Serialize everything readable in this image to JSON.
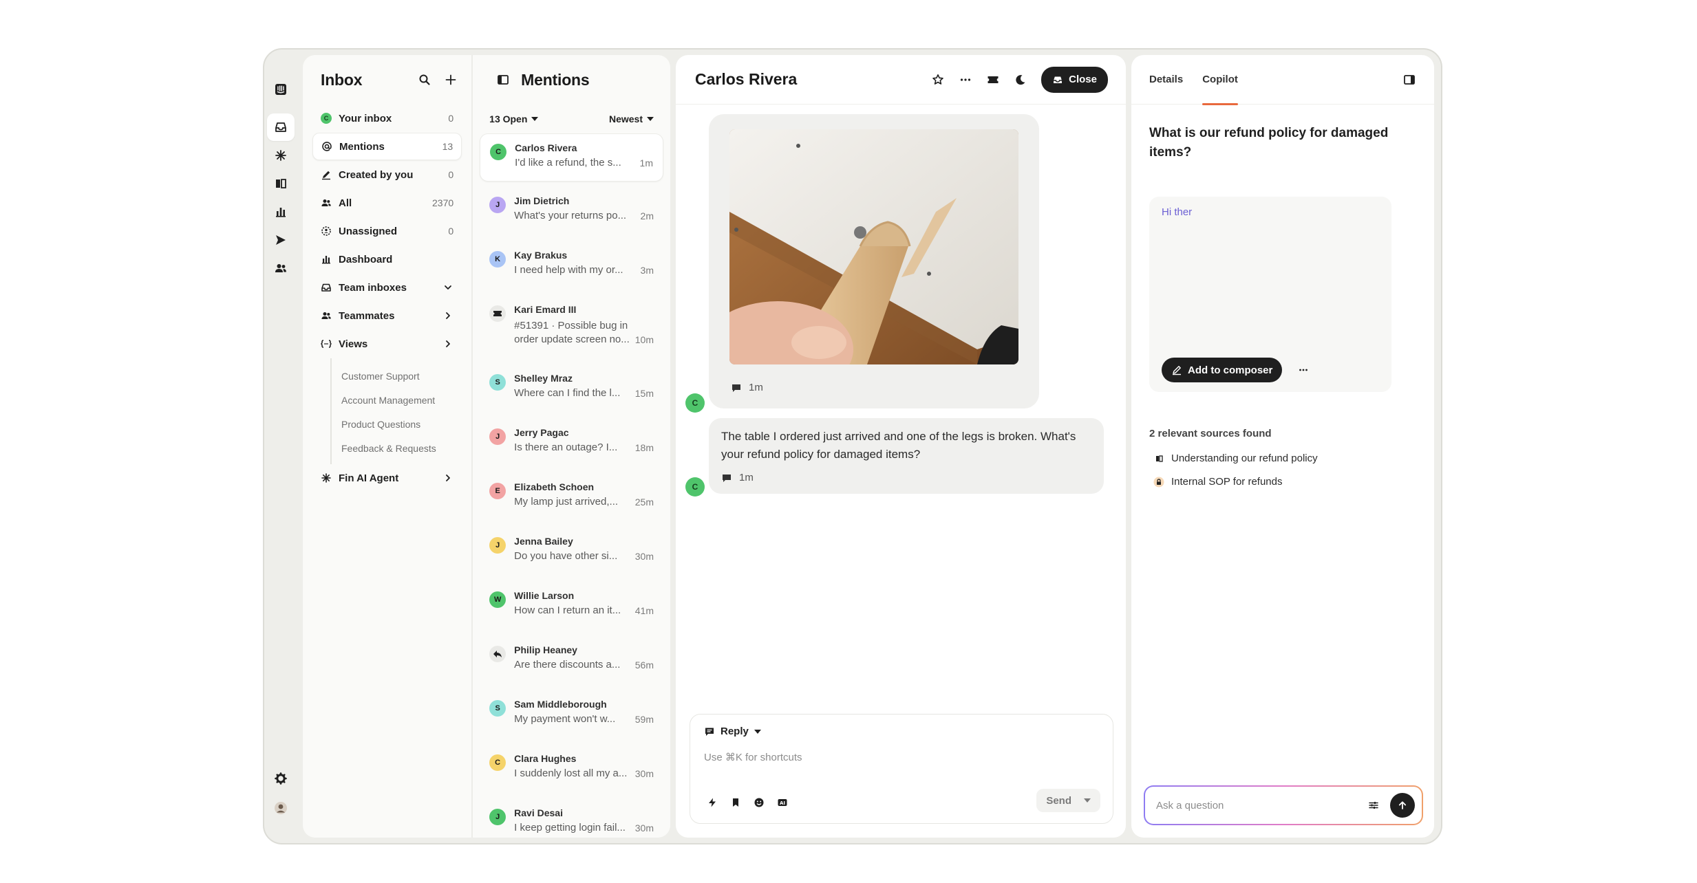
{
  "inbox": {
    "title": "Inbox",
    "nav": [
      {
        "label": "Your inbox",
        "count": "0",
        "icon": "your-inbox-avatar-icon"
      },
      {
        "label": "Mentions",
        "count": "13",
        "icon": "at-sign-icon"
      },
      {
        "label": "Created by you",
        "count": "0",
        "icon": "pen-icon"
      },
      {
        "label": "All",
        "count": "2370",
        "icon": "people-icon"
      },
      {
        "label": "Unassigned",
        "count": "0",
        "icon": "unassigned-icon"
      },
      {
        "label": "Dashboard",
        "icon": "bar-chart-icon"
      },
      {
        "label": "Team inboxes",
        "icon": "tray-icon"
      },
      {
        "label": "Teammates",
        "icon": "people-icon"
      },
      {
        "label": "Views",
        "icon": "views-icon"
      }
    ],
    "views": [
      "Customer Support",
      "Account Management",
      "Product Questions",
      "Feedback & Requests"
    ],
    "fin": {
      "label": "Fin AI Agent"
    }
  },
  "mentions": {
    "title": "Mentions",
    "filter_open": "13 Open",
    "filter_sort": "Newest",
    "conversations": [
      {
        "initial": "C",
        "color": "#4fc46b",
        "name": "Carlos Rivera",
        "preview": "I'd like a refund, the s...",
        "time": "1m"
      },
      {
        "initial": "J",
        "color": "#b9a6f2",
        "name": "Jim Dietrich",
        "preview": "What's your returns po...",
        "time": "2m"
      },
      {
        "initial": "K",
        "color": "#a9c4f5",
        "name": "Kay Brakus",
        "preview": "I need help with my or...",
        "time": "3m"
      },
      {
        "initial": "",
        "color": "#e9e9e6",
        "name": "Kari Emard III",
        "preview": "#51391 · Possible bug in",
        "preview2": "order update screen no...",
        "time": "10m"
      },
      {
        "initial": "S",
        "color": "#8fe0d8",
        "name": "Shelley Mraz",
        "preview": "Where can I find the l...",
        "time": "15m"
      },
      {
        "initial": "J",
        "color": "#f2a3a3",
        "name": "Jerry Pagac",
        "preview": "Is there an outage? I...",
        "time": "18m"
      },
      {
        "initial": "E",
        "color": "#f2a3a3",
        "name": "Elizabeth Schoen",
        "preview": "My lamp just arrived,...",
        "time": "25m"
      },
      {
        "initial": "J",
        "color": "#f5d36a",
        "name": "Jenna Bailey",
        "preview": "Do you have other si...",
        "time": "30m"
      },
      {
        "initial": "W",
        "color": "#4fc46b",
        "name": "Willie Larson",
        "preview": "How can I return an it...",
        "time": "41m"
      },
      {
        "initial": "",
        "color": "#e9e9e6",
        "name": "Philip Heaney",
        "preview": "Are there discounts a...",
        "time": "56m"
      },
      {
        "initial": "S",
        "color": "#8fe0d8",
        "name": "Sam Middleborough",
        "preview": "My payment won't w...",
        "time": "59m"
      },
      {
        "initial": "C",
        "color": "#f5d36a",
        "name": "Clara Hughes",
        "preview": "I suddenly lost all my a...",
        "time": "30m"
      },
      {
        "initial": "J",
        "color": "#4fc46b",
        "name": "Ravi Desai",
        "preview": "I keep getting login fail...",
        "time": "30m"
      }
    ]
  },
  "chat": {
    "title": "Carlos Rivera",
    "close_label": "Close",
    "customer_initial": "C",
    "image_meta_time": "1m",
    "message": "The table I ordered just arrived and one of the legs is broken. What's your refund policy for damaged items?",
    "message_time": "1m",
    "composer": {
      "mode": "Reply",
      "placeholder": "Use ⌘K for shortcuts",
      "send_label": "Send"
    }
  },
  "copilot": {
    "tabs": [
      "Details",
      "Copilot"
    ],
    "question": "What is our refund policy for damaged items?",
    "answer": "Hi ther",
    "add_label": "Add to composer",
    "sources_heading": "2 relevant sources found",
    "sources": [
      "Understanding our refund policy",
      "Internal SOP for refunds"
    ],
    "ask_placeholder": "Ask a question"
  },
  "colors": {
    "accent": "#e8693d",
    "dark": "#1f1f1f",
    "answer_text": "#6b5fd3"
  }
}
